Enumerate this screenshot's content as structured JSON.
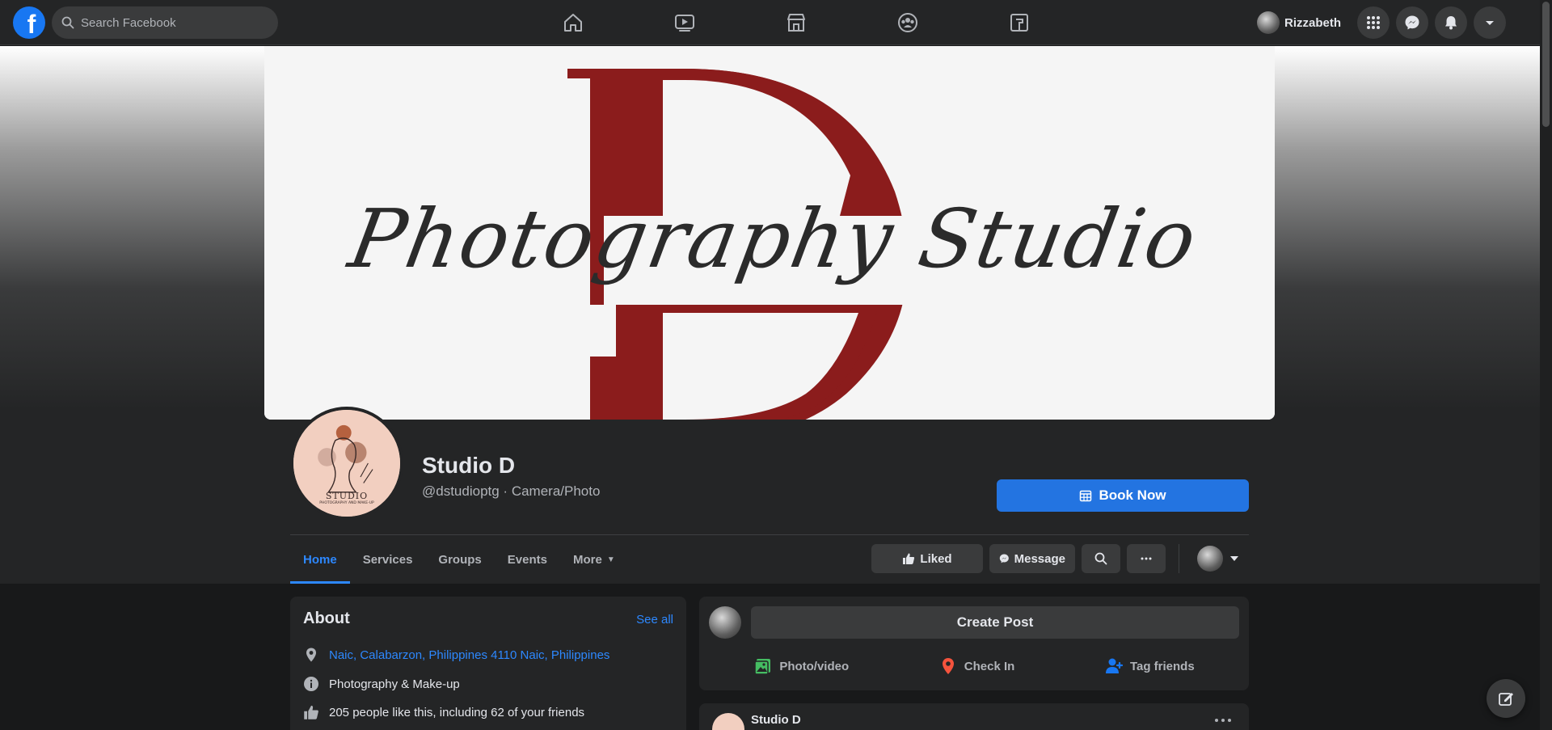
{
  "topbar": {
    "logo_letter": "f",
    "search_placeholder": "Search Facebook",
    "nav_icons": [
      "home-icon",
      "watch-icon",
      "marketplace-icon",
      "groups-icon",
      "gaming-icon"
    ],
    "user_name": "Rizzabeth",
    "right_icons": [
      "menu-grid-icon",
      "messenger-icon",
      "notifications-icon",
      "account-caret-icon"
    ]
  },
  "cover": {
    "logo_letter": "D",
    "script_text": "Photography Studio",
    "accent_color": "#8b1c1c"
  },
  "profile": {
    "name": "Studio D",
    "subtitle": "@dstudioptg · Camera/Photo",
    "pic_text": "STUDIO",
    "pic_subtext": "PHOTOGRAPHY AND MAKE-UP"
  },
  "cta": {
    "book_label": "Book Now"
  },
  "tabs": [
    {
      "label": "Home",
      "active": true
    },
    {
      "label": "Services",
      "active": false
    },
    {
      "label": "Groups",
      "active": false
    },
    {
      "label": "Events",
      "active": false
    },
    {
      "label": "More",
      "active": false
    }
  ],
  "actions": {
    "liked_label": "Liked",
    "message_label": "Message"
  },
  "about": {
    "title": "About",
    "see_all": "See all",
    "location": "Naic, Calabarzon, Philippines 4110 Naic, Philippines",
    "category": "Photography & Make-up",
    "likes": "205 people like this, including 62 of your friends"
  },
  "create_post": {
    "label": "Create Post",
    "photo_video": "Photo/video",
    "check_in": "Check In",
    "tag_friends": "Tag friends"
  },
  "post": {
    "author": "Studio D"
  },
  "colors": {
    "accent_blue": "#2374e1",
    "link_blue": "#2d88ff",
    "bg": "#18191a",
    "card": "#242526"
  }
}
